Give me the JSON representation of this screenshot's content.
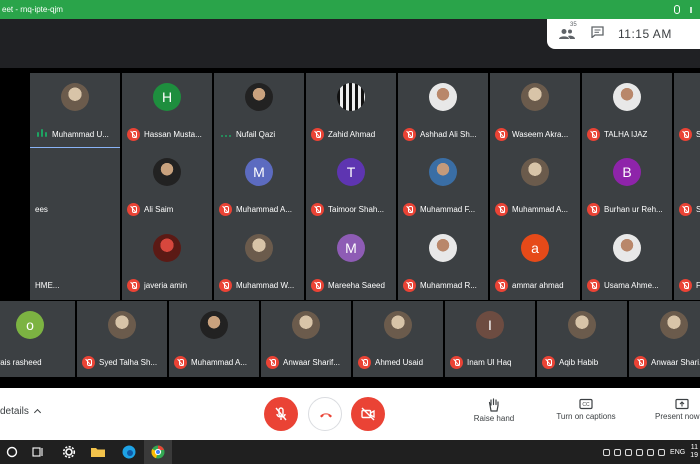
{
  "browser": {
    "tab_title": "eet - rnq-ipte-qjm"
  },
  "meeting": {
    "participant_count": "35",
    "clock": "11:15 AM",
    "details_label": "details"
  },
  "colors": {
    "accent_green": "#2aa44a",
    "muted_red": "#ea4335",
    "speaking_green": "#1ea362",
    "tile_bg": "#3c4043"
  },
  "participants": [
    {
      "row": 0,
      "col": 0,
      "name": "Muhammad U...",
      "avatar": "photo",
      "style": "photo",
      "state": "speaking",
      "active": true
    },
    {
      "row": 0,
      "col": 1,
      "name": "Hassan Musta...",
      "avatar": "H",
      "color": "#1e8e3e",
      "state": "muted"
    },
    {
      "row": 0,
      "col": 2,
      "name": "Nufail Qazi",
      "avatar": "photo",
      "style": "dark",
      "state": "talking"
    },
    {
      "row": 0,
      "col": 3,
      "name": "Zahid Ahmad",
      "avatar": "photo",
      "style": "stripe",
      "state": "muted"
    },
    {
      "row": 0,
      "col": 4,
      "name": "Ashhad Ali Sh...",
      "avatar": "photo",
      "style": "light",
      "state": "muted"
    },
    {
      "row": 0,
      "col": 5,
      "name": "Waseem Akra...",
      "avatar": "photo",
      "style": "photo",
      "state": "muted"
    },
    {
      "row": 0,
      "col": 6,
      "name": "TALHA IJAZ",
      "avatar": "photo",
      "style": "light",
      "state": "muted"
    },
    {
      "row": 0,
      "col": 7,
      "name": "S",
      "avatar": "",
      "color": "#3c4043",
      "state": "muted"
    },
    {
      "row": 1,
      "col": 0,
      "name": "ees",
      "avatar": "",
      "color": "#3c4043",
      "state": "none"
    },
    {
      "row": 1,
      "col": 1,
      "name": "Ali Saim",
      "avatar": "photo",
      "style": "dark",
      "state": "muted"
    },
    {
      "row": 1,
      "col": 2,
      "name": "Muhammad A...",
      "avatar": "M",
      "color": "#5c6bc0",
      "state": "muted"
    },
    {
      "row": 1,
      "col": 3,
      "name": "Taimoor Shah...",
      "avatar": "T",
      "color": "#5e35b1",
      "state": "muted"
    },
    {
      "row": 1,
      "col": 4,
      "name": "Muhammad F...",
      "avatar": "photo",
      "style": "blue",
      "state": "muted"
    },
    {
      "row": 1,
      "col": 5,
      "name": "Muhammad A...",
      "avatar": "photo",
      "style": "photo",
      "state": "muted"
    },
    {
      "row": 1,
      "col": 6,
      "name": "Burhan ur Reh...",
      "avatar": "B",
      "color": "#8e24aa",
      "state": "muted"
    },
    {
      "row": 1,
      "col": 7,
      "name": "Shabahat Has...",
      "avatar": "S",
      "color": "#d81b60",
      "state": "muted"
    },
    {
      "row": 2,
      "col": 0,
      "name": "HME...",
      "avatar": "",
      "color": "#3c4043",
      "state": "none"
    },
    {
      "row": 2,
      "col": 1,
      "name": "javeria amin",
      "avatar": "photo",
      "style": "red",
      "state": "muted"
    },
    {
      "row": 2,
      "col": 2,
      "name": "Muhammad W...",
      "avatar": "photo",
      "style": "photo",
      "state": "muted"
    },
    {
      "row": 2,
      "col": 3,
      "name": "Mareeha Saeed",
      "avatar": "M",
      "color": "#8e5cb5",
      "state": "muted"
    },
    {
      "row": 2,
      "col": 4,
      "name": "Muhammad R...",
      "avatar": "photo",
      "style": "light",
      "state": "muted"
    },
    {
      "row": 2,
      "col": 5,
      "name": "ammar ahmad",
      "avatar": "a",
      "color": "#e64a19",
      "state": "muted"
    },
    {
      "row": 2,
      "col": 6,
      "name": "Usama Ahme...",
      "avatar": "photo",
      "style": "light",
      "state": "muted"
    },
    {
      "row": 2,
      "col": 7,
      "name": "Fahad Sadiq",
      "avatar": "photo",
      "style": "light",
      "state": "muted"
    },
    {
      "row": 3,
      "col": 0,
      "name": "owais rasheed",
      "avatar": "o",
      "color": "#7cb342",
      "state": "none"
    },
    {
      "row": 3,
      "col": 1,
      "name": "Syed Talha Sh...",
      "avatar": "photo",
      "style": "photo",
      "state": "muted"
    },
    {
      "row": 3,
      "col": 2,
      "name": "Muhammad A...",
      "avatar": "photo",
      "style": "dark",
      "state": "muted"
    },
    {
      "row": 3,
      "col": 3,
      "name": "Anwaar Sharif...",
      "avatar": "photo",
      "style": "photo",
      "state": "muted"
    },
    {
      "row": 3,
      "col": 4,
      "name": "Ahmed Usaid",
      "avatar": "photo",
      "style": "photo",
      "state": "muted"
    },
    {
      "row": 3,
      "col": 5,
      "name": "Inam Ul Haq",
      "avatar": "I",
      "color": "#6d4c41",
      "state": "muted"
    },
    {
      "row": 3,
      "col": 6,
      "name": "Aqib Habib",
      "avatar": "photo",
      "style": "photo",
      "state": "muted"
    },
    {
      "row": 3,
      "col": 7,
      "name": "Anwaar Shari...",
      "avatar": "photo",
      "style": "photo",
      "state": "muted"
    }
  ],
  "controls": {
    "raise_hand": "Raise hand",
    "captions": "Turn on captions",
    "present": "Present now"
  },
  "taskbar": {
    "lang": "ENG",
    "time": "11",
    "date": "19"
  }
}
